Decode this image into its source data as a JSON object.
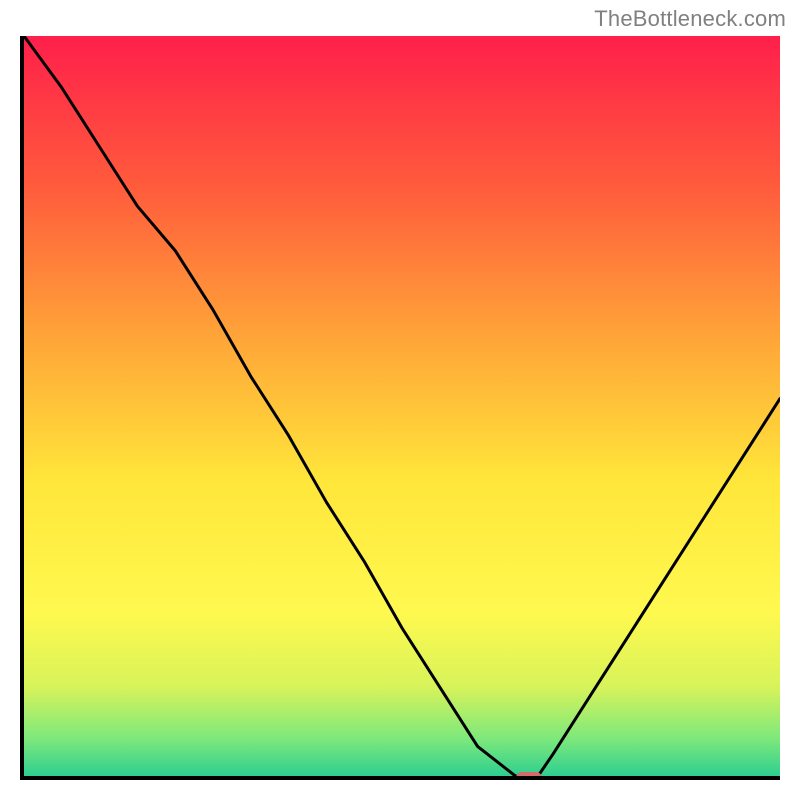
{
  "watermark": "TheBottleneck.com",
  "chart_data": {
    "type": "line",
    "title": "",
    "xlabel": "",
    "ylabel": "",
    "x": [
      0.0,
      0.05,
      0.1,
      0.15,
      0.2,
      0.25,
      0.3,
      0.35,
      0.4,
      0.45,
      0.5,
      0.55,
      0.6,
      0.65,
      0.68,
      0.7,
      0.75,
      0.8,
      0.85,
      0.9,
      0.95,
      1.0
    ],
    "values": [
      1.0,
      0.93,
      0.85,
      0.77,
      0.71,
      0.63,
      0.54,
      0.46,
      0.37,
      0.29,
      0.2,
      0.12,
      0.04,
      0.0,
      0.0,
      0.03,
      0.11,
      0.19,
      0.27,
      0.35,
      0.43,
      0.51
    ],
    "xlim": [
      0,
      1
    ],
    "ylim": [
      0,
      1
    ],
    "legend": false,
    "grid": false,
    "marker": {
      "x": 0.665,
      "y": 0.0,
      "color": "#d46a6a"
    },
    "background_gradient": {
      "stops": [
        {
          "offset": 0.0,
          "color": "#ff1f4b"
        },
        {
          "offset": 0.2,
          "color": "#ff5a3c"
        },
        {
          "offset": 0.4,
          "color": "#ffa238"
        },
        {
          "offset": 0.6,
          "color": "#ffe63a"
        },
        {
          "offset": 0.78,
          "color": "#fff94f"
        },
        {
          "offset": 0.88,
          "color": "#d7f35a"
        },
        {
          "offset": 0.95,
          "color": "#7de87c"
        },
        {
          "offset": 1.0,
          "color": "#2ecf8f"
        }
      ]
    }
  }
}
